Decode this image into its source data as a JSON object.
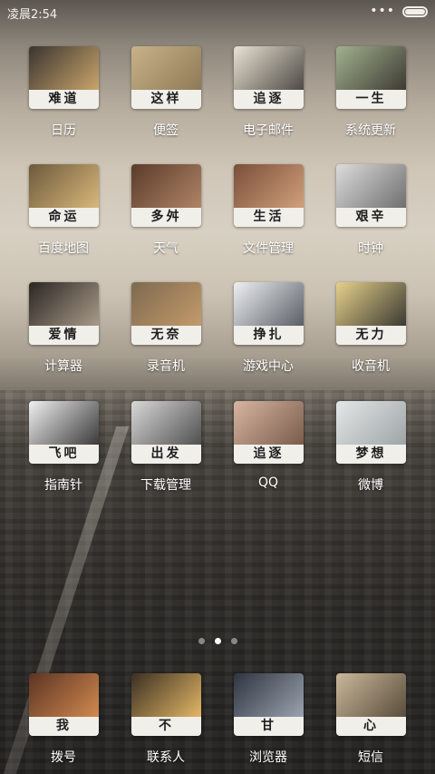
{
  "status": {
    "time": "凌晨2:54",
    "menu_dots": "•••"
  },
  "apps": [
    {
      "caption": "难道",
      "label": "日历",
      "photo": [
        "#3a3530",
        "#c9a46a"
      ]
    },
    {
      "caption": "这样",
      "label": "便签",
      "photo": [
        "#c8b28a",
        "#8f7a55"
      ]
    },
    {
      "caption": "追逐",
      "label": "电子邮件",
      "photo": [
        "#e9e2d4",
        "#4e4a44"
      ]
    },
    {
      "caption": "一生",
      "label": "系统更新",
      "photo": [
        "#9fb28e",
        "#3f3a33"
      ]
    },
    {
      "caption": "命运",
      "label": "百度地图",
      "photo": [
        "#6c5a3c",
        "#d9b77a"
      ]
    },
    {
      "caption": "多舛",
      "label": "天气",
      "photo": [
        "#5a3b2a",
        "#b08466"
      ]
    },
    {
      "caption": "生活",
      "label": "文件管理",
      "photo": [
        "#7a4e3a",
        "#d1a07a"
      ]
    },
    {
      "caption": "艰辛",
      "label": "时钟",
      "photo": [
        "#dcdcdc",
        "#6f6f6f"
      ]
    },
    {
      "caption": "爱情",
      "label": "计算器",
      "photo": [
        "#2b2623",
        "#a89a88"
      ]
    },
    {
      "caption": "无奈",
      "label": "录音机",
      "photo": [
        "#7d6a50",
        "#c49a6a"
      ]
    },
    {
      "caption": "挣扎",
      "label": "游戏中心",
      "photo": [
        "#eef0f2",
        "#5a5f66"
      ]
    },
    {
      "caption": "无力",
      "label": "收音机",
      "photo": [
        "#e6d08a",
        "#3b3a33"
      ]
    },
    {
      "caption": "飞吧",
      "label": "指南针",
      "photo": [
        "#f0f0f0",
        "#3a3a3a"
      ]
    },
    {
      "caption": "出发",
      "label": "下载管理",
      "photo": [
        "#d8d8d8",
        "#505050"
      ]
    },
    {
      "caption": "追逐",
      "label": "QQ",
      "photo": [
        "#d7b5a0",
        "#7a5c4c"
      ]
    },
    {
      "caption": "梦想",
      "label": "微博",
      "photo": [
        "#e4e7e7",
        "#9ea4a6"
      ]
    }
  ],
  "dock": [
    {
      "caption": "我",
      "label": "拨号",
      "photo": [
        "#5b3423",
        "#d2894f"
      ]
    },
    {
      "caption": "不",
      "label": "联系人",
      "photo": [
        "#3a2f24",
        "#e3b765"
      ]
    },
    {
      "caption": "甘",
      "label": "浏览器",
      "photo": [
        "#2e3440",
        "#9aa3ad"
      ]
    },
    {
      "caption": "心",
      "label": "短信",
      "photo": [
        "#c9b89a",
        "#5a4c3c"
      ]
    }
  ],
  "page_indicator": {
    "count": 3,
    "active": 1
  }
}
